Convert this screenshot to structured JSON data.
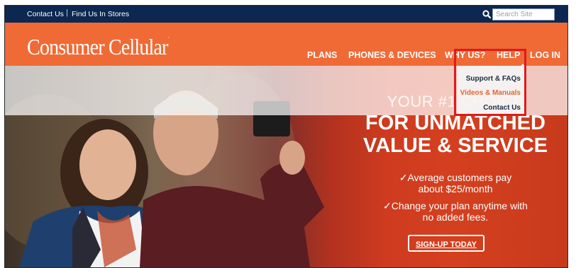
{
  "topbar": {
    "contact": "Contact Us",
    "separator": "|",
    "stores": "Find Us In Stores",
    "search_placeholder": "Search Site"
  },
  "brand": {
    "logo": "Consumer Cellular",
    "logo_mark": "·"
  },
  "nav": {
    "items": [
      {
        "label": "PLANS"
      },
      {
        "label": "PHONES & DEVICES"
      },
      {
        "label": "WHY US?"
      },
      {
        "label": "HELP"
      },
      {
        "label": "LOG IN"
      }
    ]
  },
  "help_menu": {
    "items": [
      {
        "label": "Support & FAQs"
      },
      {
        "label": "Videos & Manuals"
      },
      {
        "label": "Contact Us"
      }
    ]
  },
  "hero": {
    "headline_1": "YOUR #1 CHOICE",
    "headline_2": "FOR UNMATCHED",
    "headline_3": "VALUE & SERVICE",
    "bullet_1_line_1": "✓Average customers pay",
    "bullet_1_line_2": "about $25/month",
    "bullet_2_line_1": "✓Change your plan anytime with",
    "bullet_2_line_2": "no added fees.",
    "cta": "SIGN-UP TODAY"
  },
  "colors": {
    "topbar": "#0c2750",
    "navbar": "#f06a35",
    "highlight": "#e01b1b",
    "menu_active": "#e8642f"
  }
}
